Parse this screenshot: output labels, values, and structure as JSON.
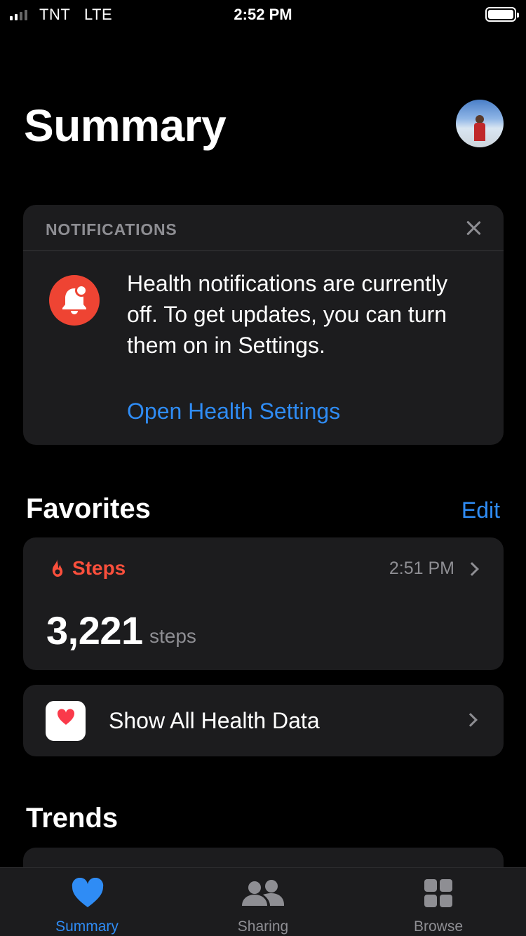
{
  "status_bar": {
    "carrier": "TNT",
    "network": "LTE",
    "time": "2:52 PM"
  },
  "header": {
    "title": "Summary"
  },
  "notifications": {
    "title": "NOTIFICATIONS",
    "message": "Health notifications are currently off. To get updates, you can turn them on in Settings.",
    "link": "Open Health Settings",
    "accent_color": "#ee4433"
  },
  "favorites": {
    "title": "Favorites",
    "edit_label": "Edit",
    "steps": {
      "label": "Steps",
      "time": "2:51 PM",
      "value": "3,221",
      "unit": "steps",
      "color": "#fa4f3c"
    },
    "show_all_label": "Show All Health Data"
  },
  "trends": {
    "title": "Trends"
  },
  "tab_bar": {
    "tabs": [
      {
        "label": "Summary",
        "icon": "heart-icon",
        "active": true
      },
      {
        "label": "Sharing",
        "icon": "people-icon",
        "active": false
      },
      {
        "label": "Browse",
        "icon": "grid-icon",
        "active": false
      }
    ],
    "active_color": "#2f8cf5"
  }
}
